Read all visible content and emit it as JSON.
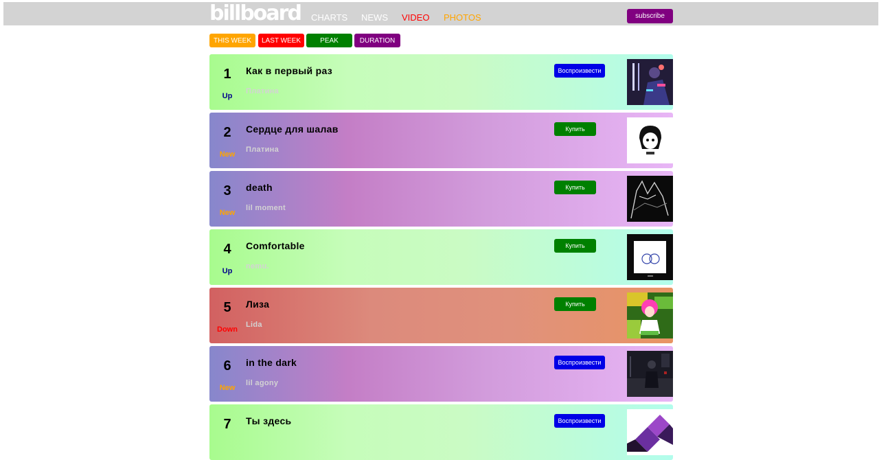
{
  "logo": "billboard",
  "nav": [
    {
      "label": "CHARTS",
      "color": "#ffffff"
    },
    {
      "label": "NEWS",
      "color": "#ffffff"
    },
    {
      "label": "VIDEO",
      "color": "#ff0000"
    },
    {
      "label": "PHOTOS",
      "color": "#ffa500"
    }
  ],
  "subscribe_label": "subscribe",
  "tabs": [
    {
      "label": "THIS WEEK",
      "color": "#ffa500"
    },
    {
      "label": "LAST WEEK",
      "color": "#ff0000"
    },
    {
      "label": "PEAK",
      "color": "#008000"
    },
    {
      "label": "DURATION",
      "color": "#800080"
    }
  ],
  "rows": [
    {
      "rank": "1",
      "status": "Up",
      "status_color": "#00008b",
      "title": "Как в первый раз",
      "artist": "Платина",
      "artist_color": "#d3d3d3",
      "action": "Воспроизвести",
      "action_kind": "play",
      "gradient": "green"
    },
    {
      "rank": "2",
      "status": "New",
      "status_color": "#ffa500",
      "title": "Сердце для шалав",
      "artist": "Платина",
      "artist_color": "#d3d3d3",
      "action": "Купить",
      "action_kind": "buy",
      "gradient": "purple"
    },
    {
      "rank": "3",
      "status": "New",
      "status_color": "#ffa500",
      "title": "death",
      "artist": "lil moment",
      "artist_color": "#d3d3d3",
      "action": "Купить",
      "action_kind": "buy",
      "gradient": "purple"
    },
    {
      "rank": "4",
      "status": "Up",
      "status_color": "#00008b",
      "title": "Comfortable",
      "artist": "nemu.",
      "artist_color": "#d3d3d3",
      "action": "Купить",
      "action_kind": "buy",
      "gradient": "green"
    },
    {
      "rank": "5",
      "status": "Down",
      "status_color": "#ff0000",
      "title": "Лиза",
      "artist": "Lida",
      "artist_color": "#d3d3d3",
      "action": "Купить",
      "action_kind": "buy",
      "gradient": "red"
    },
    {
      "rank": "6",
      "status": "New",
      "status_color": "#ffa500",
      "title": "in the dark",
      "artist": "lil agony",
      "artist_color": "#d3d3d3",
      "action": "Воспроизвести",
      "action_kind": "play",
      "gradient": "purple"
    },
    {
      "rank": "7",
      "status": "",
      "status_color": "#00008b",
      "title": "Ты здесь",
      "artist": "",
      "artist_color": "#d3d3d3",
      "action": "Воспроизвести",
      "action_kind": "play",
      "gradient": "green"
    }
  ]
}
